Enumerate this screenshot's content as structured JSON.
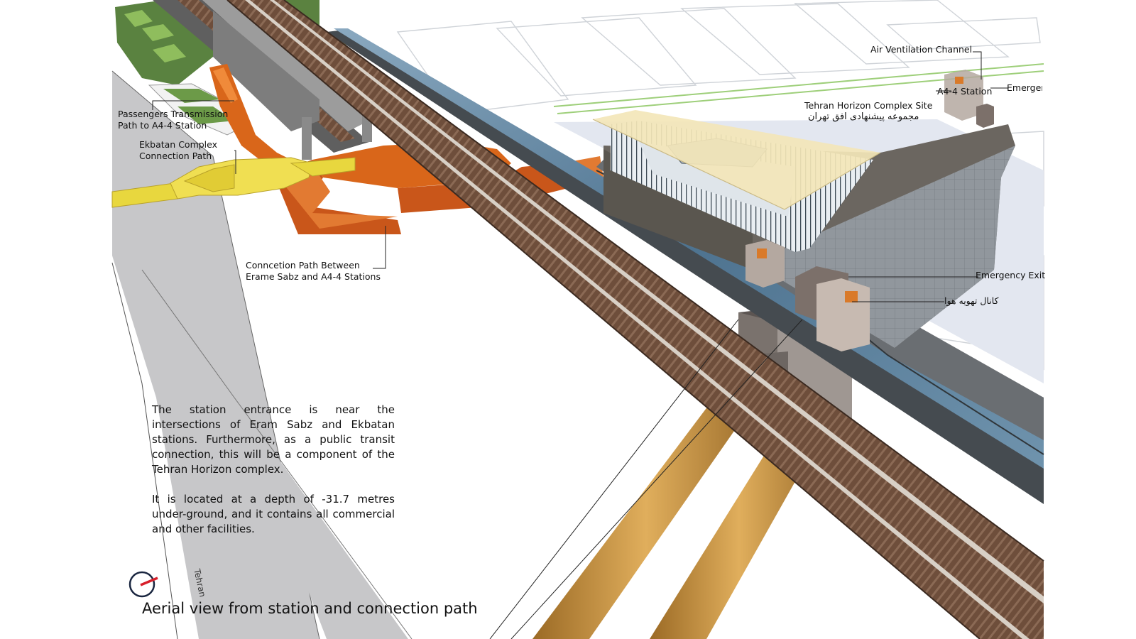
{
  "caption": "Aerial view from station and connection path",
  "description": [
    "The station entrance is near the intersections of Eram Sabz and Ekbatan stations. Furthermore, as a public transit connection, this will be a component of the Tehran Horizon complex.",
    "It is located at a depth of -31.7 metres under-ground, and it contains all commercial and other facilities."
  ],
  "labels": {
    "passengers_path_1": "Passengers Transmission",
    "passengers_path_2": "Path to A4-4 Station",
    "ekbatan_path_1": "Ekbatan Complex",
    "ekbatan_path_2": "Connection Path",
    "connection_path_1": "Conncetion Path Between",
    "connection_path_2": "Erame Sabz and A4-4 Stations",
    "air_channel": "Air Ventilation Channel",
    "a44_station": "A4-4 Station",
    "emergency_top": "Emerger",
    "horizon_site_en": "Tehran Horizon Complex Site",
    "horizon_site_fa": "مجموعه پیشنهادی افق تهران",
    "emergency_exit": "Emergency Exit",
    "air_channel_fa": "کانال تهویه هوا",
    "tehran": "Tehran"
  },
  "colors": {
    "orange_path": "#d9661a",
    "yellow_path": "#e6d43a",
    "water_channel": "#5d7f97",
    "road_gray": "#c6c6c8",
    "tunnel_tan": "#c8923c",
    "rail_brown": "#7a5a45",
    "green_road": "#9ecf7a",
    "roof": "#f3e6b8"
  },
  "icons": [
    "north-arrow-icon"
  ]
}
